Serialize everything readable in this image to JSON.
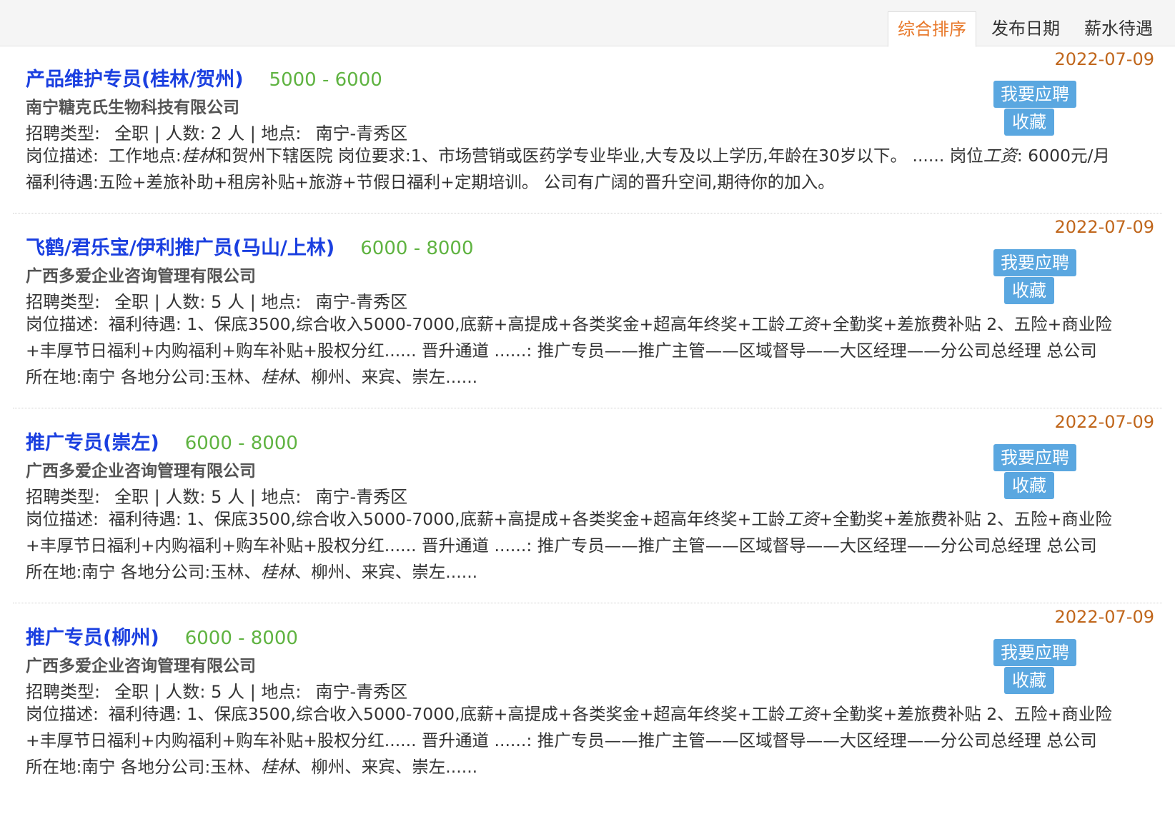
{
  "sort_tabs": [
    {
      "label": "综合排序",
      "active": true
    },
    {
      "label": "发布日期",
      "active": false
    },
    {
      "label": "薪水待遇",
      "active": false
    }
  ],
  "labels": {
    "apply": "我要应聘",
    "favorite": "收藏",
    "type_label": "招聘类型:",
    "count_label": "人数:",
    "location_label": "地点:",
    "desc_label": "岗位描述:"
  },
  "jobs": [
    {
      "title": "产品维护专员(桂林/贺州)",
      "salary": "5000 - 6000",
      "date": "2022-07-09",
      "company": "南宁糖克氏生物科技有限公司",
      "type": "全职",
      "count": "2 人",
      "location": "南宁-青秀区",
      "desc": [
        {
          "t": "工作地点:"
        },
        {
          "t": "桂林",
          "em": true
        },
        {
          "t": "和贺州下辖医院 岗位要求:1、市场营销或医药学专业毕业,大专及以上学历,年龄在30岁以下。 ...... 岗位"
        },
        {
          "t": "工资",
          "em": true
        },
        {
          "t": ": 6000元/月 福利待遇:五险+差旅补助+租房补贴+旅游+节假日福利+定期培训。 公司有广阔的晋升空间,期待你的加入。"
        }
      ]
    },
    {
      "title": "飞鹤/君乐宝/伊利推广员(马山/上林)",
      "salary": "6000 - 8000",
      "date": "2022-07-09",
      "company": "广西多爱企业咨询管理有限公司",
      "type": "全职",
      "count": "5 人",
      "location": "南宁-青秀区",
      "desc": [
        {
          "t": "福利待遇: 1、保底3500,综合收入5000-7000,底薪+高提成+各类奖金+超高年终奖+工龄"
        },
        {
          "t": "工资",
          "em": true
        },
        {
          "t": "+全勤奖+差旅费补贴 2、五险+商业险+丰厚节日福利+内购福利+购车补贴+股权分红...... 晋升通道 ......: 推广专员——推广主管——区域督导——大区经理——分公司总经理 总公司所在地:南宁 各地分公司:玉林、"
        },
        {
          "t": "桂林",
          "em": true
        },
        {
          "t": "、柳州、来宾、崇左......"
        }
      ]
    },
    {
      "title": "推广专员(崇左)",
      "salary": "6000 - 8000",
      "date": "2022-07-09",
      "company": "广西多爱企业咨询管理有限公司",
      "type": "全职",
      "count": "5 人",
      "location": "南宁-青秀区",
      "desc": [
        {
          "t": "福利待遇: 1、保底3500,综合收入5000-7000,底薪+高提成+各类奖金+超高年终奖+工龄"
        },
        {
          "t": "工资",
          "em": true
        },
        {
          "t": "+全勤奖+差旅费补贴 2、五险+商业险+丰厚节日福利+内购福利+购车补贴+股权分红...... 晋升通道 ......: 推广专员——推广主管——区域督导——大区经理——分公司总经理 总公司所在地:南宁 各地分公司:玉林、"
        },
        {
          "t": "桂林",
          "em": true
        },
        {
          "t": "、柳州、来宾、崇左......"
        }
      ]
    },
    {
      "title": "推广专员(柳州)",
      "salary": "6000 - 8000",
      "date": "2022-07-09",
      "company": "广西多爱企业咨询管理有限公司",
      "type": "全职",
      "count": "5 人",
      "location": "南宁-青秀区",
      "desc": [
        {
          "t": "福利待遇: 1、保底3500,综合收入5000-7000,底薪+高提成+各类奖金+超高年终奖+工龄"
        },
        {
          "t": "工资",
          "em": true
        },
        {
          "t": "+全勤奖+差旅费补贴 2、五险+商业险+丰厚节日福利+内购福利+购车补贴+股权分红...... 晋升通道 ......: 推广专员——推广主管——区域督导——大区经理——分公司总经理 总公司所在地:南宁 各地分公司:玉林、"
        },
        {
          "t": "桂林",
          "em": true
        },
        {
          "t": "、柳州、来宾、崇左......"
        }
      ]
    }
  ]
}
